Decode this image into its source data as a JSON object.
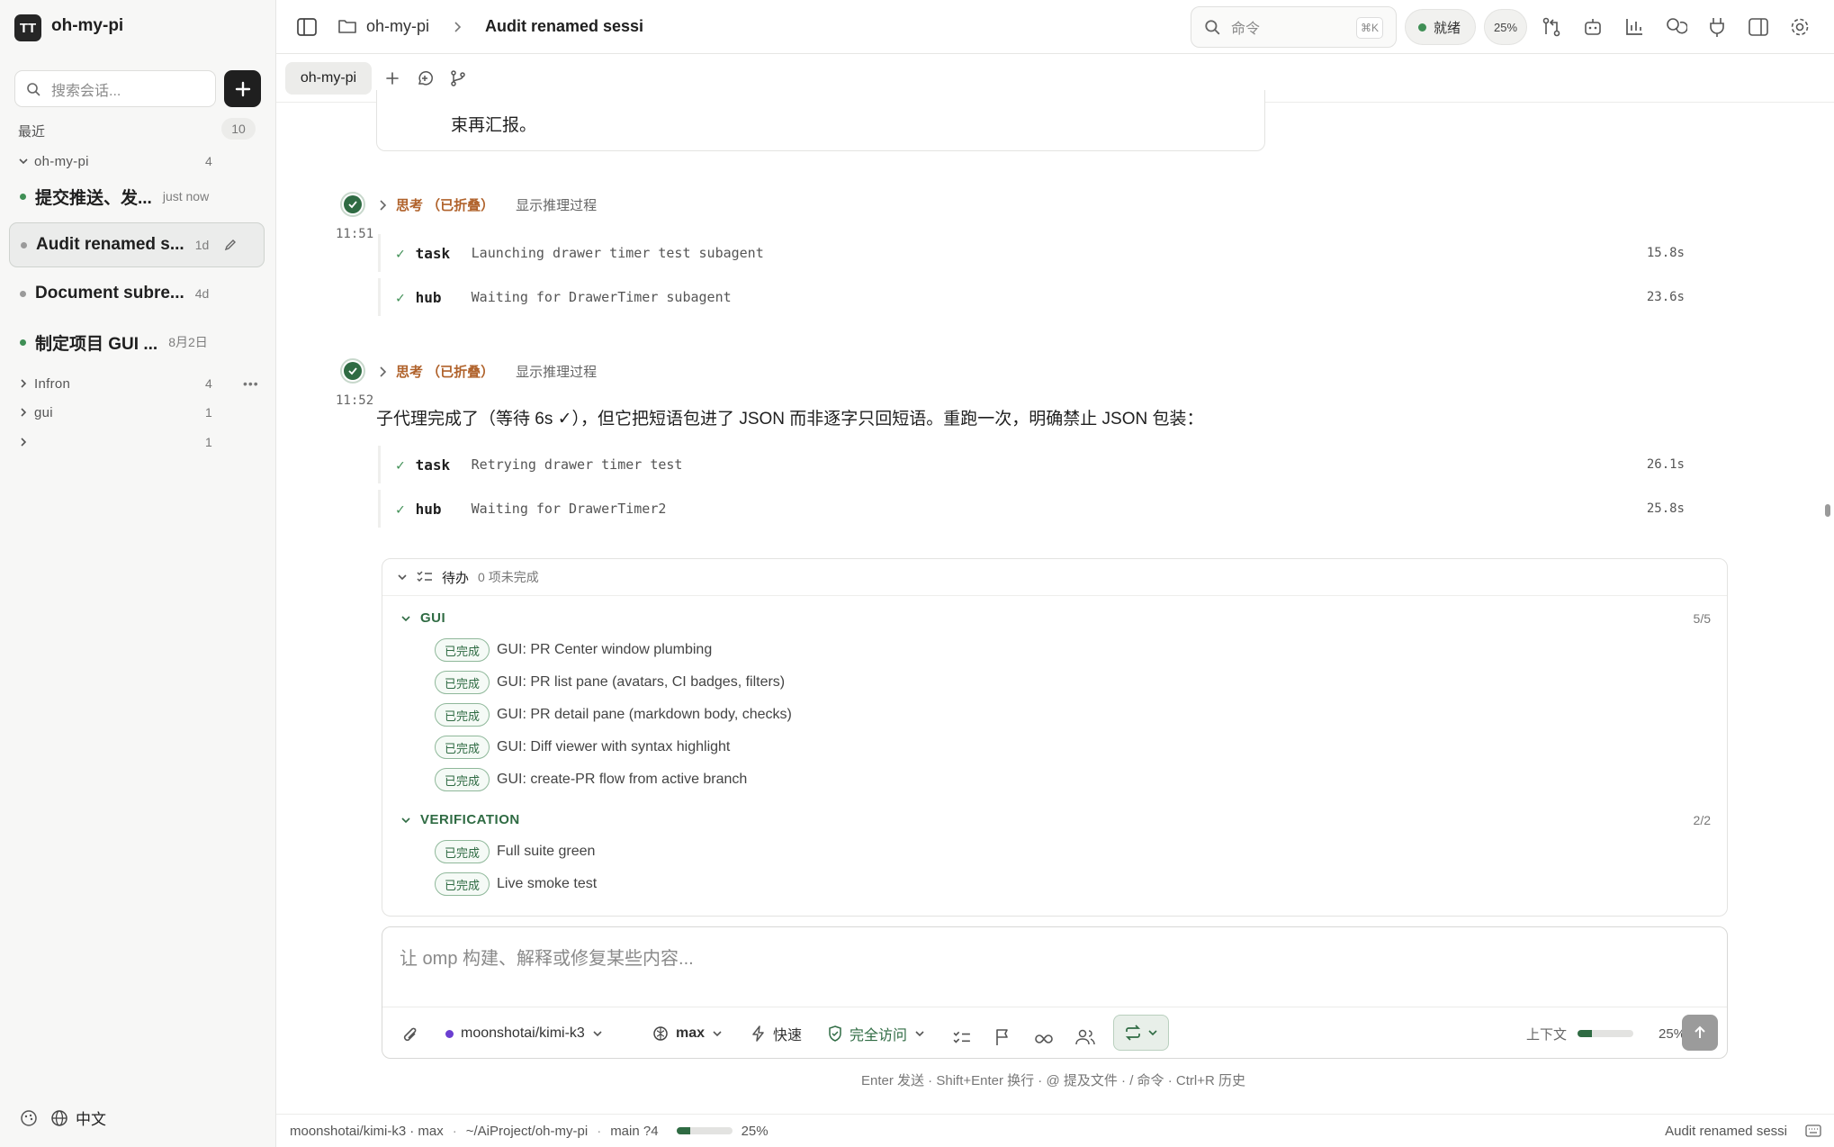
{
  "sidebar": {
    "app_name": "oh-my-pi",
    "logo_text": "TT",
    "search_placeholder": "搜索会话...",
    "recent_label": "最近",
    "recent_count": "10",
    "groups": [
      {
        "name": "oh-my-pi",
        "count": "4",
        "expanded": true
      },
      {
        "name": "Infron",
        "count": "4",
        "expanded": false
      },
      {
        "name": "gui",
        "count": "1",
        "expanded": false
      },
      {
        "name": "",
        "count": "1",
        "expanded": false
      }
    ],
    "sessions": [
      {
        "title": "提交推送、发...",
        "meta": "just now",
        "status": "green"
      },
      {
        "title": "Audit renamed s...",
        "meta": "1d",
        "status": "gray",
        "active": true
      },
      {
        "title": "Document subre...",
        "meta": "4d",
        "status": "gray"
      },
      {
        "title": "制定项目 GUI ...",
        "meta": "8月2日",
        "status": "green"
      }
    ],
    "language": "中文"
  },
  "topbar": {
    "breadcrumb_project": "oh-my-pi",
    "breadcrumb_session": "Audit renamed sessi",
    "command_placeholder": "命令",
    "command_shortcut": "⌘K",
    "status": "就绪",
    "context_pct": "25%"
  },
  "tabs": [
    {
      "label": "oh-my-pi"
    }
  ],
  "chat": {
    "prev_message_tail": "束再汇报。",
    "blocks": [
      {
        "time": "11:51",
        "thinking_label": "思考 （已折叠）",
        "thinking_action": "显示推理过程",
        "tools": [
          {
            "name": "task",
            "desc": "Launching drawer timer test subagent",
            "duration": "15.8s"
          },
          {
            "name": "hub",
            "desc": "Waiting for DrawerTimer subagent",
            "duration": "23.6s"
          }
        ]
      },
      {
        "time": "11:52",
        "thinking_label": "思考 （已折叠）",
        "thinking_action": "显示推理过程",
        "message": "子代理完成了（等待 6s ✓），但它把短语包进了 JSON 而非逐字只回短语。重跑一次，明确禁止 JSON 包装：",
        "tools": [
          {
            "name": "task",
            "desc": "Retrying drawer timer test",
            "duration": "26.1s"
          },
          {
            "name": "hub",
            "desc": "Waiting for DrawerTimer2",
            "duration": "25.8s"
          }
        ]
      }
    ]
  },
  "todo": {
    "title": "待办",
    "summary": "0 项未完成",
    "badge_label": "已完成",
    "sections": [
      {
        "name": "GUI",
        "count": "5/5",
        "items": [
          "GUI: PR Center window plumbing",
          "GUI: PR list pane (avatars, CI badges, filters)",
          "GUI: PR detail pane (markdown body, checks)",
          "GUI: Diff viewer with syntax highlight",
          "GUI: create-PR flow from active branch"
        ]
      },
      {
        "name": "VERIFICATION",
        "count": "2/2",
        "items": [
          "Full suite green",
          "Live smoke test"
        ]
      }
    ]
  },
  "composer": {
    "placeholder": "让 omp 构建、解释或修复某些内容...",
    "model": "moonshotai/kimi-k3",
    "effort": "max",
    "speed": "快速",
    "access": "完全访问",
    "context_label": "上下文",
    "context_pct": "25%",
    "context_fraction": 0.25,
    "hint": "Enter 发送 · Shift+Enter 换行 · @ 提及文件 · / 命令 · Ctrl+R 历史"
  },
  "statusbar": {
    "model": "moonshotai/kimi-k3",
    "effort": "· max",
    "path": "~/AiProject/oh-my-pi",
    "branch": "main ?4",
    "context_pct": "25%",
    "context_fraction": 0.25,
    "session": "Audit renamed sessi"
  },
  "colors": {
    "accent": "#2f6b43",
    "thinking": "#b0622b",
    "status_green": "#3f8f55"
  }
}
